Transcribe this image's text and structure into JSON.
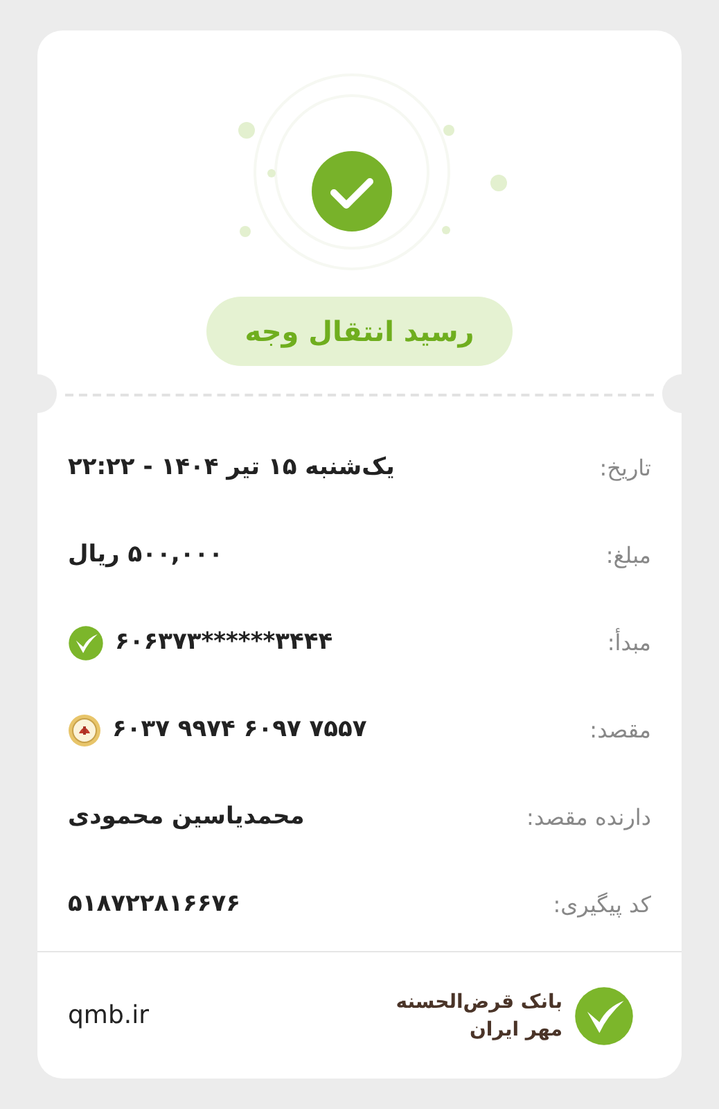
{
  "header": {
    "title": "رسید انتقال وجه"
  },
  "rows": [
    {
      "kind": "plain",
      "label": "تاریخ:",
      "value": "یک‌شنبه ۱۵ تیر ۱۴۰۴ - ۲۲:۲۲"
    },
    {
      "kind": "plain",
      "label": "مبلغ:",
      "value": "۵۰۰,۰۰۰ ریال"
    },
    {
      "kind": "card_check",
      "label": "مبدأ:",
      "value": "۶۰۶۳۷۳******۳۴۴۴"
    },
    {
      "kind": "card_seal",
      "label": "مقصد:",
      "value": "۶۰۳۷ ۹۹۷۴ ۶۰۹۷ ۷۵۵۷"
    },
    {
      "kind": "plain",
      "label": "دارنده مقصد:",
      "value": "محمدیاسین محمودی"
    },
    {
      "kind": "plain",
      "label": "کد پیگیری:",
      "value": "۵۱۸۷۲۲۸۱۶۶۷۶"
    }
  ],
  "footer": {
    "brand_lines": [
      "بانک قرض‌الحسنه",
      "مهر ایران"
    ],
    "website": "qmb.ir"
  }
}
